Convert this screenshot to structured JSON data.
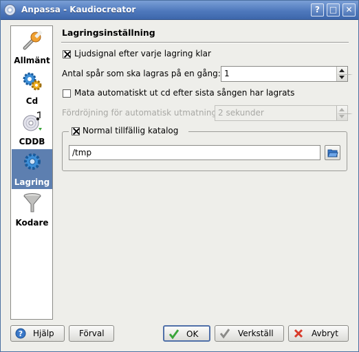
{
  "window": {
    "title": "Anpassa - Kaudiocreator",
    "help_glyph": "?",
    "maximize_glyph": "□",
    "close_glyph": "✕"
  },
  "sidebar": {
    "items": [
      {
        "label": "Allmänt",
        "icon": "wrench-icon",
        "selected": false
      },
      {
        "label": "Cd",
        "icon": "gears-icon",
        "selected": false
      },
      {
        "label": "CDDB",
        "icon": "cd-music-icon",
        "selected": false
      },
      {
        "label": "Lagring",
        "icon": "gear-icon",
        "selected": true
      },
      {
        "label": "Kodare",
        "icon": "funnel-icon",
        "selected": false
      }
    ]
  },
  "page": {
    "title": "Lagringsinställning",
    "beep_checkbox": {
      "label": "Ljudsignal efter varje lagring klar",
      "checked": true
    },
    "tracks_label": "Antal spår som ska lagras på en gång:",
    "tracks_value": "1",
    "eject_checkbox": {
      "label": "Mata automatiskt ut cd efter sista sången har lagrats",
      "checked": false
    },
    "delay_label": "Fördröjning för automatisk utmatning:",
    "delay_value": "2 sekunder",
    "tempdir_checkbox": {
      "label": "Normal tillfällig katalog",
      "checked": true
    },
    "tempdir_value": "/tmp"
  },
  "buttons": {
    "help": "Hjälp",
    "defaults": "Förval",
    "ok": "OK",
    "apply": "Verkställ",
    "cancel": "Avbryt"
  },
  "colors": {
    "titlebar": "#4f79bd",
    "selection": "#5d7fb0"
  }
}
